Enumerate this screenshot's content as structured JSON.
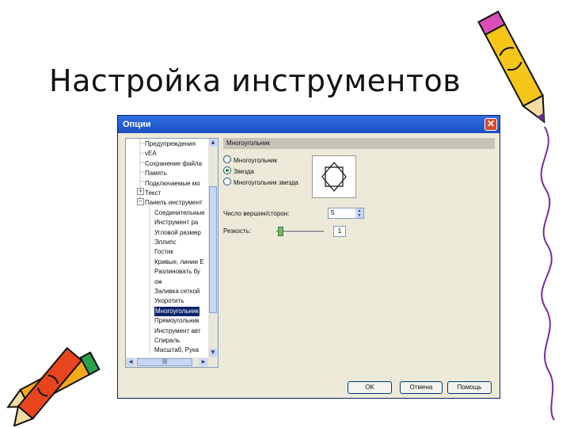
{
  "slide": {
    "title": "Настройка инструментов"
  },
  "dialog": {
    "title": "Опции",
    "close_glyph": "✕",
    "tree": {
      "items": [
        "Предупреждения",
        "vEA",
        "Сохранение файла",
        "Память",
        "Подключаемые мо",
        "Текст",
        "Панель инструмент",
        "Соединительные",
        "Инструмент ра",
        "Угловой размер",
        "Эллипс",
        "Гостик",
        "Кривые, линии Е",
        "Разлиновать бу",
        "ож",
        "Заливка сеткой",
        "Укоротить",
        "Многоугольник",
        "Прямоугольник",
        "Инструмент авт",
        "Спираль",
        "Масштаб, Рука"
      ],
      "selected_index": 17,
      "expand_glyph": "+",
      "collapse_glyph": "−",
      "scroll_up": "▲",
      "scroll_down": "▼",
      "scroll_left": "◀",
      "scroll_right": "▶",
      "hthumb_grip": "|||"
    },
    "pane": {
      "header": "Многоугольник",
      "radios": [
        "Многоугольник",
        "Звезда",
        "Многоугольник звезда"
      ],
      "radio_selected": 1,
      "vertices_label": "Число вершин/сторон:",
      "vertices_value": "5",
      "sharpness_label": "Резкость:",
      "sharpness_value": "1",
      "spin_up": "▲",
      "spin_down": "▼"
    },
    "buttons": {
      "ok": "OK",
      "cancel": "Отмена",
      "help": "Помощь"
    }
  }
}
